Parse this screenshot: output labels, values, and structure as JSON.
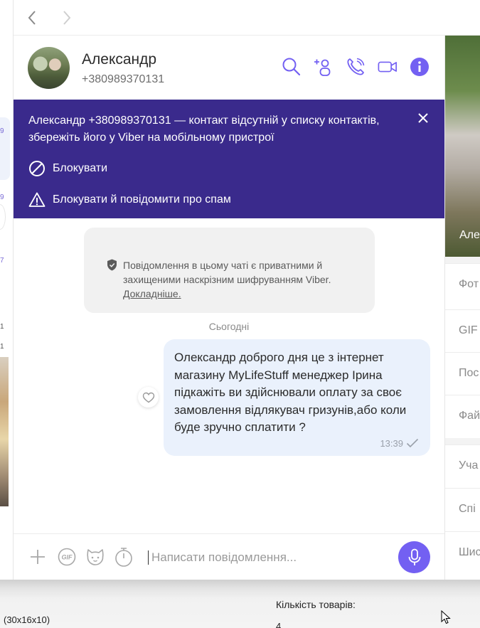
{
  "nav": {
    "back_label": "<",
    "forward_label": ">"
  },
  "left_strip": {
    "fragments": [
      "9",
      "9",
      "7",
      "1",
      "1"
    ]
  },
  "contact": {
    "name": "Александр",
    "phone": "+380989370131"
  },
  "header_icons": [
    "search-icon",
    "add-participant-icon",
    "call-icon",
    "video-call-icon",
    "info-icon"
  ],
  "banner": {
    "text": "Александр +380989370131 — контакт відсутній у списку контактів, збережіть його у Viber на мобільному пристрої",
    "block_label": "Блокувати",
    "block_report_label": "Блокувати й повідомити про спам"
  },
  "privacy_notice": {
    "text": "Повідомлення в цьому чаті є приватними й захищеними наскрізним шифруванням Viber.",
    "link": "Докладніше."
  },
  "date_separator": "Сьогодні",
  "message": {
    "text": "Олександр доброго дня це з інтернет магазину MyLifeStuff менеджер Ірина підкажіть ви здійснювали оплату за своє замовлення відлякувач гризунів,або коли буде зручно сплатити ?",
    "time": "13:39",
    "status": "sent"
  },
  "composer": {
    "placeholder": "Написати повідомлення..."
  },
  "right_panel": {
    "photo_label": "Але",
    "items": [
      "Фот",
      "GIF",
      "Пос",
      "Фай",
      "Уча",
      "Спі",
      "Шис"
    ]
  },
  "bottom_page": {
    "dims": "(30x16x10)",
    "qty_label": "Кількість товарів:",
    "qty_value": "4"
  },
  "colors": {
    "accent": "#7360f2",
    "banner_bg": "#3a2a8c",
    "bubble_bg": "#eaf1fc"
  }
}
